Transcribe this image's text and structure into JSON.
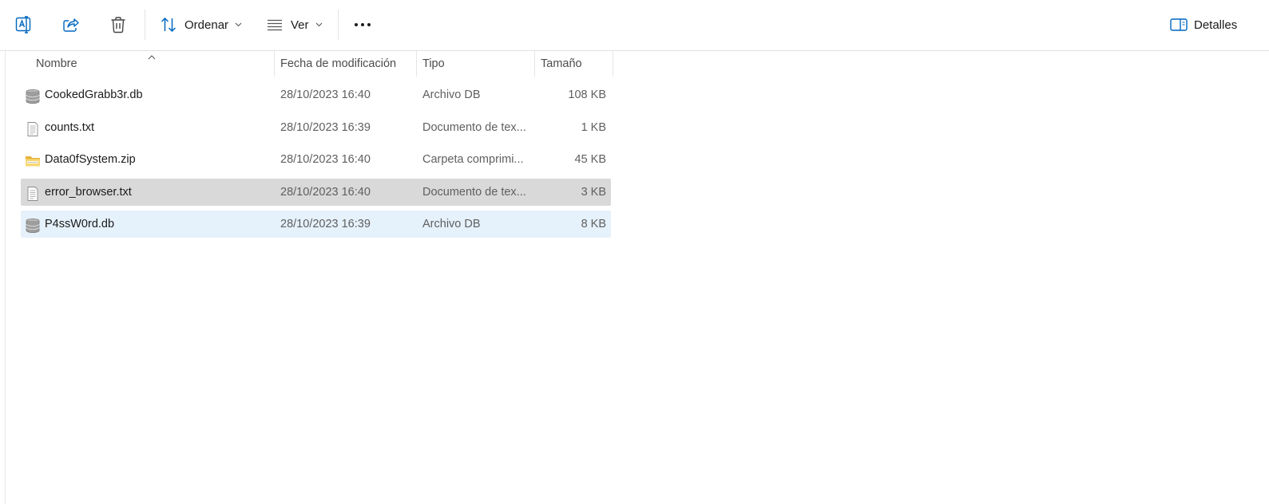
{
  "toolbar": {
    "buttons": [
      {
        "icon": "rename-icon"
      },
      {
        "icon": "share-icon"
      },
      {
        "icon": "delete-icon"
      }
    ],
    "sort_label": "Ordenar",
    "view_label": "Ver",
    "more_icon": "more-icon",
    "details_label": "Detalles",
    "accent_color": "#0067c0"
  },
  "columns": {
    "name": "Nombre",
    "date": "Fecha de modificación",
    "type": "Tipo",
    "size": "Tamaño"
  },
  "files": [
    {
      "name": "CookedGrabb3r.db",
      "date": "28/10/2023 16:40",
      "type": "Archivo DB",
      "size": "108 KB",
      "icon": "database-icon",
      "state": "normal"
    },
    {
      "name": "counts.txt",
      "date": "28/10/2023 16:39",
      "type": "Documento de tex...",
      "size": "1 KB",
      "icon": "text-file-icon",
      "state": "normal"
    },
    {
      "name": "Data0fSystem.zip",
      "date": "28/10/2023 16:40",
      "type": "Carpeta comprimi...",
      "size": "45 KB",
      "icon": "zip-folder-icon",
      "state": "normal"
    },
    {
      "name": "error_browser.txt",
      "date": "28/10/2023 16:40",
      "type": "Documento de tex...",
      "size": "3 KB",
      "icon": "text-file-icon",
      "state": "selected"
    },
    {
      "name": "P4ssW0rd.db",
      "date": "28/10/2023 16:39",
      "type": "Archivo DB",
      "size": "8 KB",
      "icon": "database-icon",
      "state": "hover"
    }
  ]
}
